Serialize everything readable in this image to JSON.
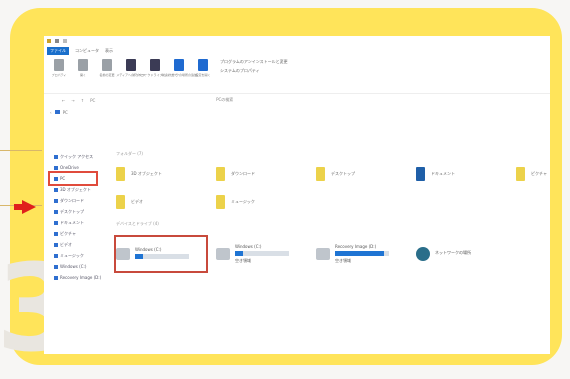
{
  "window": {
    "ribbon_tabs": [
      "ファイル",
      "コンピュータ",
      "表示"
    ],
    "ribbon_buttons": [
      {
        "label": "プロパティ",
        "icon": "properties-icon"
      },
      {
        "label": "開く",
        "icon": "open-icon"
      },
      {
        "label": "名前の変更",
        "icon": "rename-icon"
      },
      {
        "label": "メディアへのアクセス",
        "icon": "media-icon"
      },
      {
        "label": "ネットワークドライブの割り当て",
        "icon": "network-drive-icon"
      },
      {
        "label": "ネットワークの場所の追加",
        "icon": "network-location-icon"
      },
      {
        "label": "設定を開く",
        "icon": "settings-icon"
      }
    ],
    "ribbon_side": [
      "プログラムのアンインストールと変更",
      "システムのプロパティ"
    ],
    "address": {
      "back": "←",
      "forward": "→",
      "up": "↑",
      "path": "PC",
      "search_placeholder": "PCの検索"
    },
    "crumbs": [
      "‹",
      "PC"
    ]
  },
  "nav": [
    {
      "label": "クイック アクセス"
    },
    {
      "label": "OneDrive"
    },
    {
      "label": "PC",
      "selected": true
    },
    {
      "label": "3D オブジェクト"
    },
    {
      "label": "ダウンロード"
    },
    {
      "label": "デスクトップ"
    },
    {
      "label": "ドキュメント"
    },
    {
      "label": "ピクチャ"
    },
    {
      "label": "ビデオ"
    },
    {
      "label": "ミュージック"
    },
    {
      "label": "Windows (C:)"
    },
    {
      "label": "Recovery Image (D:)"
    }
  ],
  "main": {
    "folders_header": "フォルダー (7)",
    "folders": [
      {
        "label": "3D オブジェクト",
        "icon": "folder-icon"
      },
      {
        "label": "ダウンロード",
        "icon": "folder-icon"
      },
      {
        "label": "デスクトップ",
        "icon": "folder-icon"
      },
      {
        "label": "ドキュメント",
        "icon": "folder-icon"
      },
      {
        "label": "ピクチャ",
        "icon": "folder-icon"
      },
      {
        "label": "ビデオ",
        "icon": "folder-icon"
      },
      {
        "label": "ミュージック",
        "icon": "folder-icon"
      }
    ],
    "devices_header": "デバイスとドライブ (4)",
    "drives": [
      {
        "label": "Windows (C:)",
        "detail": "",
        "usage": 0.15,
        "selected": true
      },
      {
        "label": "Windows (C:)",
        "detail": "空き領域",
        "usage": 0.15
      },
      {
        "label": "Recovery Image (D:)",
        "detail": "空き領域",
        "usage": 0.9
      },
      {
        "label": "ネットワークの場所",
        "detail": "",
        "usage": null
      }
    ]
  },
  "colors": {
    "accent": "#1a6fcb",
    "frame": "#ffe45a",
    "highlight": "#e0201c"
  }
}
